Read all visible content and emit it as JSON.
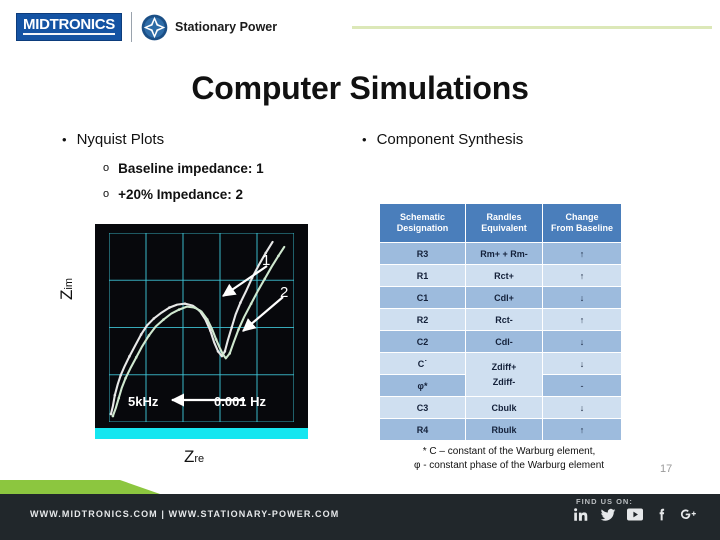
{
  "header": {
    "logo_text": "MIDTRONICS",
    "brand_text": "Stationary Power",
    "star_icon": "star-badge-icon"
  },
  "title": "Computer Simulations",
  "bullets": {
    "left": {
      "marker": "•",
      "label": "Nyquist Plots",
      "sub_marker": "o",
      "sub_items": [
        "Baseline impedance: 1",
        "+20% Impedance: 2"
      ]
    },
    "right": {
      "marker": "•",
      "label": "Component Synthesis"
    }
  },
  "chart_data": {
    "type": "line",
    "title": "Nyquist Plots",
    "xlabel": "Zre",
    "ylabel": "Zim",
    "x_axis_label_main": "Z",
    "x_axis_label_sub": "re",
    "y_axis_label_main": "Z",
    "y_axis_label_sub": "im",
    "grid": true,
    "grid_cols": 5,
    "grid_rows": 4,
    "background": "#07080c",
    "grid_color": "#3fc6d8",
    "annotations": [
      {
        "text": "1",
        "series": "Baseline impedance"
      },
      {
        "text": "2",
        "series": "+20% Impedance"
      },
      {
        "text": "5kHz",
        "role": "high-frequency-end"
      },
      {
        "text": "0.001 Hz",
        "role": "low-frequency-end"
      }
    ],
    "series": [
      {
        "name": "1",
        "label": "Baseline impedance",
        "color": "#e8e8e8",
        "points": [
          [
            2,
            8
          ],
          [
            4,
            16
          ],
          [
            6,
            27
          ],
          [
            9,
            38
          ],
          [
            12,
            47
          ],
          [
            16,
            56
          ],
          [
            21,
            66
          ],
          [
            27,
            77
          ],
          [
            33,
            88
          ],
          [
            39,
            97
          ],
          [
            46,
            104
          ],
          [
            54,
            110
          ],
          [
            62,
            115
          ],
          [
            70,
            118
          ],
          [
            78,
            119
          ],
          [
            86,
            117
          ],
          [
            93,
            112
          ],
          [
            99,
            103
          ],
          [
            104,
            92
          ],
          [
            108,
            80
          ],
          [
            112,
            71
          ],
          [
            116,
            66
          ],
          [
            119,
            71
          ],
          [
            122,
            82
          ],
          [
            126,
            95
          ],
          [
            130,
            108
          ],
          [
            135,
            120
          ],
          [
            141,
            132
          ],
          [
            147,
            145
          ],
          [
            154,
            158
          ],
          [
            161,
            170
          ],
          [
            168,
            181
          ]
        ]
      },
      {
        "name": "2",
        "label": "+20% Impedance",
        "color": "#cfe8cf",
        "points": [
          [
            4,
            6
          ],
          [
            7,
            14
          ],
          [
            10,
            24
          ],
          [
            13,
            34
          ],
          [
            17,
            44
          ],
          [
            22,
            54
          ],
          [
            28,
            65
          ],
          [
            34,
            76
          ],
          [
            41,
            87
          ],
          [
            48,
            96
          ],
          [
            56,
            103
          ],
          [
            64,
            109
          ],
          [
            72,
            113
          ],
          [
            80,
            116
          ],
          [
            88,
            115
          ],
          [
            95,
            111
          ],
          [
            101,
            103
          ],
          [
            106,
            93
          ],
          [
            110,
            83
          ],
          [
            114,
            74
          ],
          [
            117,
            68
          ],
          [
            120,
            64
          ],
          [
            124,
            69
          ],
          [
            128,
            80
          ],
          [
            133,
            93
          ],
          [
            139,
            106
          ],
          [
            146,
            119
          ],
          [
            153,
            132
          ],
          [
            160,
            144
          ],
          [
            167,
            156
          ],
          [
            174,
            167
          ],
          [
            180,
            176
          ]
        ]
      }
    ]
  },
  "table": {
    "headers": [
      "Schematic Designation",
      "Randles Equivalent",
      "Change From Baseline"
    ],
    "headers_lines": [
      [
        "Schematic",
        "Designation"
      ],
      [
        "Randles",
        "Equivalent"
      ],
      [
        "Change",
        "From Baseline"
      ]
    ],
    "rows": [
      {
        "designation": "R3",
        "equivalent": "Rm+ + Rm-",
        "change": "↑"
      },
      {
        "designation": "R1",
        "equivalent": "Rct+",
        "change": "↑"
      },
      {
        "designation": "C1",
        "equivalent": "Cdl+",
        "change": "↓"
      },
      {
        "designation": "R2",
        "equivalent": "Rct-",
        "change": "↑"
      },
      {
        "designation": "C2",
        "equivalent": "Cdl-",
        "change": "↓"
      },
      {
        "designation": "C˙",
        "equivalent": "Zdiff+",
        "change": "↓"
      },
      {
        "designation": "φ*",
        "equivalent": "Zdiff-",
        "change": "-"
      },
      {
        "designation": "C3",
        "equivalent": "Cbulk",
        "change": "↓"
      },
      {
        "designation": "R4",
        "equivalent": "Rbulk",
        "change": "↑"
      }
    ],
    "merged_equivalent": {
      "line1": "Zdiff+",
      "line2": "Zdiff-"
    }
  },
  "footnote": {
    "line1": "* C – constant of the Warburg element,",
    "line2": "φ - constant phase of the Warburg element"
  },
  "page_number": "17",
  "footer": {
    "links": "WWW.MIDTRONICS.COM  |  WWW.STATIONARY-POWER.COM",
    "find_us": "FIND US ON:",
    "socials": [
      "linkedin-icon",
      "twitter-icon",
      "youtube-icon",
      "facebook-icon",
      "googleplus-icon"
    ]
  },
  "colors": {
    "brand_blue": "#1453a3",
    "table_header": "#4a7ebb",
    "row_dark": "#9dbbdd",
    "row_light": "#cfdff0",
    "accent_green": "#8cc63f",
    "footer_dark": "#21272b",
    "plot_cyan": "#15e6f0"
  }
}
